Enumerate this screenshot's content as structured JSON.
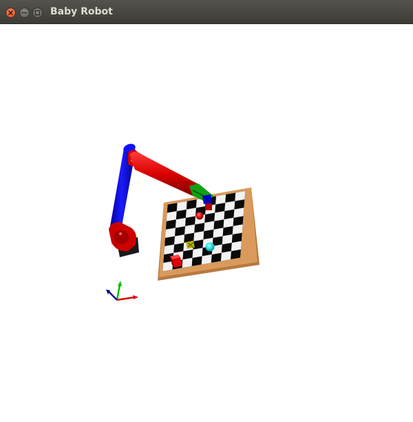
{
  "window": {
    "title": "Baby Robot",
    "buttons": {
      "close_icon": "close-icon",
      "minimize_icon": "minimize-icon",
      "maximize_icon": "maximize-icon"
    }
  },
  "scene": {
    "background": "#ffffff",
    "colors": {
      "link_blue": "#0000e0",
      "link_red": "#e00000",
      "gripper_green": "#10a010",
      "board_frame": "#c78c4f",
      "ball_red": "#cc0000",
      "ball_cyan": "#19e0e0",
      "cube_red": "#dd0000",
      "marker_yellow": "#c8c800"
    },
    "axes_gizmo": [
      "x-axis-red",
      "y-axis-green",
      "z-axis-blue"
    ]
  }
}
